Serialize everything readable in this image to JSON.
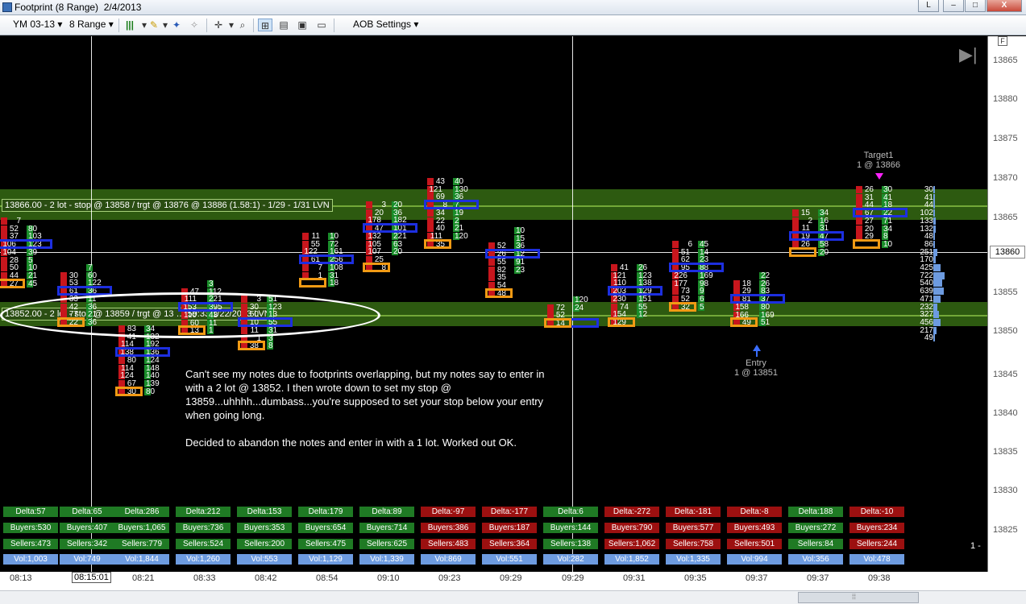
{
  "window": {
    "title": "Footprint (8 Range)  2/4/2013",
    "buttons": [
      "L",
      "–",
      "□",
      "X"
    ]
  },
  "toolbar": {
    "instrument": "YM 03-13",
    "bar_type": "8 Range",
    "aob_settings": "AOB Settings",
    "icons": [
      "bars-icon",
      "pencil-icon",
      "pin-icon",
      "crosshair-icon",
      "zoom-icon",
      "chart-style-icon",
      "image-icon",
      "save-icon"
    ]
  },
  "price_axis": {
    "labels": [
      "13865",
      "13880",
      "13875",
      "13870",
      "13865",
      "13860",
      "13855",
      "13850",
      "13845",
      "13840",
      "13835",
      "13830",
      "13825"
    ],
    "current": "13860",
    "f_button": "F",
    "right_number": "1 -"
  },
  "zones": [
    {
      "label": "13866.00 - 2 lot - stop @ 13858 / trgt @ 13876 @ 13886 (1.58:1) - 1/29 - 1/31 LVN"
    },
    {
      "label": "13852.00 - 2 lot - stop @ 13859 / trgt @ 13 … 59:33 1/22/2013 LVN"
    }
  ],
  "target": {
    "title": "Target1",
    "detail": "1 @ 13866"
  },
  "entry": {
    "title": "Entry",
    "detail": "1 @ 13851"
  },
  "note": {
    "p1": "Can't see my notes due to footprints overlapping, but my notes say to enter in with a 2 lot @ 13852.  I then wrote down to set my stop @ 13859...uhhhh...dumbass...you're supposed to set your stop below your entry when going long.",
    "p2": "Decided to abandon the notes and enter in with a 1 lot.  Worked out OK."
  },
  "stats": {
    "delta": [
      "Delta:57",
      "Delta:65",
      "Delta:286",
      "Delta:212",
      "Delta:153",
      "Delta:179",
      "Delta:89",
      "Delta:-97",
      "Delta:-177",
      "Delta:6",
      "Delta:-272",
      "Delta:-181",
      "Delta:-8",
      "Delta:188",
      "Delta:-10"
    ],
    "buyers": [
      "Buyers:530",
      "Buyers:407",
      "Buyers:1,065",
      "Buyers:736",
      "Buyers:353",
      "Buyers:654",
      "Buyers:714",
      "Buyers:386",
      "Buyers:187",
      "Buyers:144",
      "Buyers:790",
      "Buyers:577",
      "Buyers:493",
      "Buyers:272",
      "Buyers:234"
    ],
    "sellers": [
      "Sellers:473",
      "Sellers:342",
      "Sellers:779",
      "Sellers:524",
      "Sellers:200",
      "Sellers:475",
      "Sellers:625",
      "Sellers:483",
      "Sellers:364",
      "Sellers:138",
      "Sellers:1,062",
      "Sellers:758",
      "Sellers:501",
      "Sellers:84",
      "Sellers:244"
    ],
    "vol": [
      "Vol:1,003",
      "Vol:749",
      "Vol:1,844",
      "Vol:1,260",
      "Vol:553",
      "Vol:1,129",
      "Vol:1,339",
      "Vol:869",
      "Vol:551",
      "Vol:282",
      "Vol:1,852",
      "Vol:1,335",
      "Vol:994",
      "Vol:356",
      "Vol:478"
    ],
    "colors": {
      "delta": [
        "g",
        "g",
        "g",
        "g",
        "g",
        "g",
        "g",
        "r",
        "r",
        "g",
        "r",
        "r",
        "r",
        "g",
        "r"
      ],
      "buyers": [
        "g",
        "g",
        "g",
        "g",
        "g",
        "g",
        "g",
        "r",
        "r",
        "g",
        "r",
        "r",
        "r",
        "g",
        "r"
      ],
      "sellers": [
        "g",
        "g",
        "g",
        "g",
        "g",
        "g",
        "g",
        "r",
        "r",
        "g",
        "r",
        "r",
        "r",
        "g",
        "r"
      ]
    }
  },
  "time_axis": {
    "labels": [
      "08:13",
      "08:21",
      "08:33",
      "08:42",
      "08:54",
      "09:10",
      "09:23",
      "09:29",
      "09:29",
      "09:31",
      "09:35",
      "09:37",
      "09:37",
      "09:38"
    ],
    "cursor_time": "08:15:01"
  },
  "colors": {
    "buy": "#1a8d2a",
    "sell": "#c8161d",
    "poc_box": "#1d2fe0",
    "imbalance_box": "#f19a14",
    "zone": "#2d5a10"
  },
  "bars": [
    {
      "name": "bar-0813",
      "cells": [
        [
          "7",
          ""
        ],
        [
          "52",
          "80"
        ],
        [
          "37",
          "103"
        ],
        [
          "106",
          "123"
        ],
        [
          "104",
          "39"
        ],
        [
          "28",
          "5"
        ],
        [
          "50",
          "10"
        ],
        [
          "44",
          "21"
        ],
        [
          "27",
          "45"
        ]
      ]
    },
    {
      "name": "bar-0815",
      "cells": [
        [
          "",
          "7"
        ],
        [
          "30",
          "60"
        ],
        [
          "53",
          "122"
        ],
        [
          "61",
          "36"
        ],
        [
          "33",
          "11"
        ],
        [
          "42",
          "36"
        ],
        [
          "77",
          "21"
        ],
        [
          "22",
          "36"
        ]
      ]
    },
    {
      "name": "bar-0821",
      "cells": [
        [
          "83",
          "34"
        ],
        [
          "41",
          "132"
        ],
        [
          "114",
          "192"
        ],
        [
          "138",
          "136"
        ],
        [
          "80",
          "124"
        ],
        [
          "114",
          "148"
        ],
        [
          "124",
          "140"
        ],
        [
          "67",
          "139"
        ],
        [
          "30",
          "80"
        ]
      ]
    },
    {
      "name": "bar-0833",
      "cells": [
        [
          "",
          "3"
        ],
        [
          "47",
          "112"
        ],
        [
          "111",
          "221"
        ],
        [
          "153",
          "395"
        ],
        [
          "110",
          "43"
        ],
        [
          "60",
          "11"
        ],
        [
          "13",
          "1"
        ]
      ]
    },
    {
      "name": "bar-0842",
      "cells": [
        [
          "3",
          "51"
        ],
        [
          "30",
          "123"
        ],
        [
          "50",
          "13"
        ],
        [
          "10",
          "55"
        ],
        [
          "11",
          "31"
        ],
        [
          "1",
          "3"
        ],
        [
          "38",
          "8"
        ]
      ]
    },
    {
      "name": "bar-0854",
      "cells": [
        [
          "11",
          "10"
        ],
        [
          "55",
          "72"
        ],
        [
          "122",
          "161"
        ],
        [
          "61",
          "256"
        ],
        [
          "7",
          "108"
        ],
        [
          "1",
          "31"
        ],
        [
          "",
          "18"
        ]
      ]
    },
    {
      "name": "bar-0910",
      "cells": [
        [
          "3",
          "20"
        ],
        [
          "20",
          "36"
        ],
        [
          "178",
          "182"
        ],
        [
          "47",
          "101"
        ],
        [
          "132",
          "221"
        ],
        [
          "105",
          "63"
        ],
        [
          "107",
          "20"
        ],
        [
          "25",
          ""
        ],
        [
          "8",
          ""
        ]
      ]
    },
    {
      "name": "bar-0923",
      "cells": [
        [
          "43",
          "40"
        ],
        [
          "121",
          "130"
        ],
        [
          "69",
          "36"
        ],
        [
          "8",
          "7"
        ],
        [
          "34",
          "19"
        ],
        [
          "22",
          "2"
        ],
        [
          "40",
          "21"
        ],
        [
          "111",
          "120"
        ],
        [
          "35",
          ""
        ]
      ]
    },
    {
      "name": "bar-0929a",
      "cells": [
        [
          "",
          "10"
        ],
        [
          "",
          "15"
        ],
        [
          "52",
          "36"
        ],
        [
          "26",
          "12"
        ],
        [
          "55",
          "91"
        ],
        [
          "82",
          "23"
        ],
        [
          "35",
          ""
        ],
        [
          "54",
          ""
        ],
        [
          "48",
          ""
        ]
      ]
    },
    {
      "name": "bar-0929b",
      "cells": [
        [
          "",
          "120"
        ],
        [
          "72",
          "24"
        ],
        [
          "52",
          ""
        ],
        [
          "14",
          ""
        ]
      ]
    },
    {
      "name": "bar-0931",
      "cells": [
        [
          "41",
          "26"
        ],
        [
          "121",
          "123"
        ],
        [
          "110",
          "138"
        ],
        [
          "203",
          "129"
        ],
        [
          "230",
          "151"
        ],
        [
          "74",
          "55"
        ],
        [
          "154",
          "12"
        ],
        [
          "129",
          ""
        ]
      ]
    },
    {
      "name": "bar-0935",
      "cells": [
        [
          "6",
          "45"
        ],
        [
          "51",
          "14"
        ],
        [
          "62",
          "23"
        ],
        [
          "95",
          "88"
        ],
        [
          "226",
          "169"
        ],
        [
          "177",
          "98"
        ],
        [
          "73",
          "9"
        ],
        [
          "52",
          "6"
        ],
        [
          "32",
          "5"
        ]
      ]
    },
    {
      "name": "bar-0937a",
      "cells": [
        [
          "",
          "22"
        ],
        [
          "18",
          "26"
        ],
        [
          "29",
          "83"
        ],
        [
          "81",
          "37"
        ],
        [
          "158",
          "80"
        ],
        [
          "166",
          "169"
        ],
        [
          "49",
          "51"
        ]
      ]
    },
    {
      "name": "bar-0937b",
      "cells": [
        [
          "15",
          "34"
        ],
        [
          "2",
          "16"
        ],
        [
          "11",
          "31"
        ],
        [
          "19",
          "47"
        ],
        [
          "26",
          "58"
        ],
        [
          "",
          "20"
        ]
      ]
    },
    {
      "name": "bar-0938",
      "cells": [
        [
          "26",
          "30"
        ],
        [
          "31",
          "41"
        ],
        [
          "44",
          "18"
        ],
        [
          "67",
          "22"
        ],
        [
          "27",
          "71"
        ],
        [
          "20",
          "34"
        ],
        [
          "29",
          "8"
        ],
        [
          "",
          "10"
        ]
      ]
    },
    {
      "name": "bar-volume",
      "cells": [
        [
          "",
          "30"
        ],
        [
          "",
          "41"
        ],
        [
          "",
          "44"
        ],
        [
          "",
          "102"
        ],
        [
          "",
          "133"
        ],
        [
          "",
          "132"
        ],
        [
          "",
          "48"
        ],
        [
          "",
          "86"
        ],
        [
          "",
          "251"
        ],
        [
          "",
          "170"
        ],
        [
          "",
          "425"
        ],
        [
          "",
          "722"
        ],
        [
          "",
          "540"
        ],
        [
          "",
          "639"
        ],
        [
          "",
          "471"
        ],
        [
          "",
          "232"
        ],
        [
          "",
          "327"
        ],
        [
          "",
          "456"
        ],
        [
          "",
          "217"
        ],
        [
          "",
          "49"
        ]
      ]
    }
  ]
}
